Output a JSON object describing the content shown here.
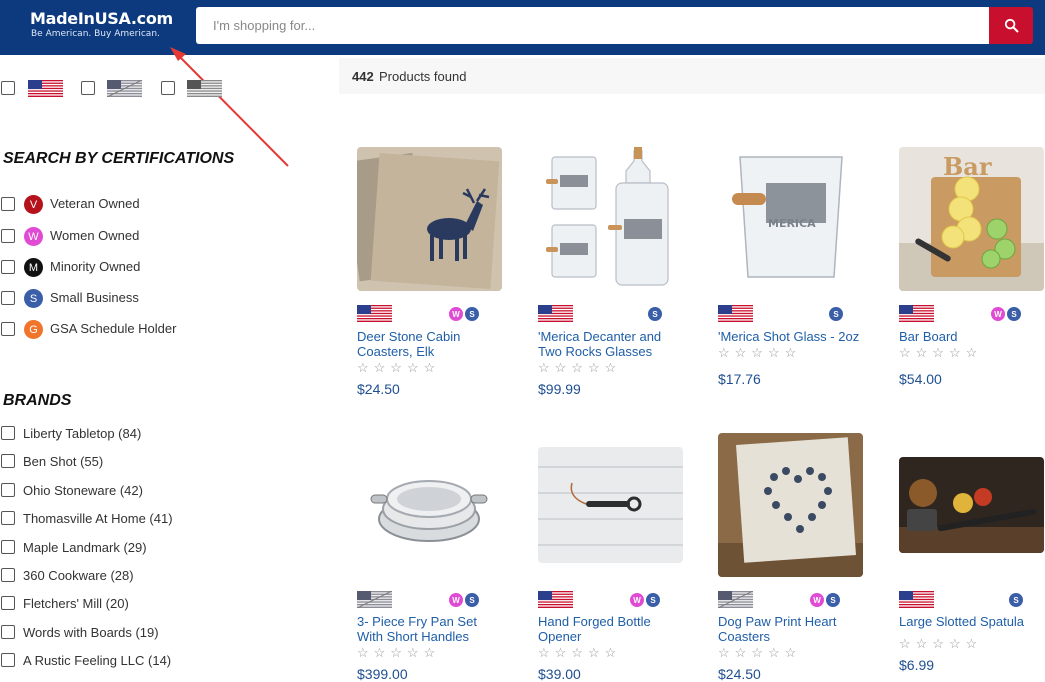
{
  "header": {
    "logo_title": "MadeInUSA.com",
    "logo_tagline": "Be American. Buy American.",
    "search_placeholder": "I'm shopping for...",
    "search_icon": "search-icon",
    "brand_color": "#0d3a7e",
    "accent_color": "#c8102e"
  },
  "sidebar": {
    "certifications_title": "SEARCH BY CERTIFICATIONS",
    "certifications": [
      {
        "letter": "V",
        "label": "Veteran Owned",
        "color": "#b5121b"
      },
      {
        "letter": "W",
        "label": "Women Owned",
        "color": "#e04bd4"
      },
      {
        "letter": "M",
        "label": "Minority Owned",
        "color": "#111111"
      },
      {
        "letter": "S",
        "label": "Small Business",
        "color": "#3a5ea8"
      },
      {
        "letter": "G",
        "label": "GSA Schedule Holder",
        "color": "#f0752b"
      }
    ],
    "brands_title": "BRANDS",
    "brands": [
      "Liberty Tabletop (84)",
      "Ben Shot (55)",
      "Ohio Stoneware (42)",
      "Thomasville At Home (41)",
      "Maple Landmark (29)",
      "360 Cookware (28)",
      "Fletchers' Mill (20)",
      "Words with Boards (19)",
      "A Rustic Feeling LLC (14)"
    ]
  },
  "results": {
    "count": "442",
    "label": "Products found"
  },
  "products": [
    {
      "title": "Deer Stone Cabin Coasters, Elk",
      "price": "$24.50",
      "flag": "usa-flag",
      "badges": [
        "W",
        "S"
      ]
    },
    {
      "title": "'Merica Decanter and Two Rocks Glasses",
      "price": "$99.99",
      "flag": "usa-flag",
      "badges": [
        "S"
      ]
    },
    {
      "title": "'Merica Shot Glass - 2oz",
      "price": "$17.76",
      "flag": "usa-flag",
      "badges": [
        "S"
      ]
    },
    {
      "title": "Bar Board",
      "price": "$54.00",
      "flag": "usa-flag",
      "badges": [
        "W",
        "S"
      ]
    },
    {
      "title": "3- Piece Fry Pan Set With Short Handles",
      "price": "$399.00",
      "flag": "usa-flag-muted",
      "badges": [
        "W",
        "S"
      ]
    },
    {
      "title": "Hand Forged Bottle Opener",
      "price": "$39.00",
      "flag": "usa-flag",
      "badges": [
        "W",
        "S"
      ]
    },
    {
      "title": "Dog Paw Print Heart Coasters",
      "price": "$24.50",
      "flag": "usa-flag-muted",
      "badges": [
        "W",
        "S"
      ]
    },
    {
      "title": "Large Slotted Spatula",
      "price": "$6.99",
      "flag": "usa-flag",
      "badges": [
        "S"
      ]
    }
  ],
  "stars": "☆☆☆☆☆"
}
